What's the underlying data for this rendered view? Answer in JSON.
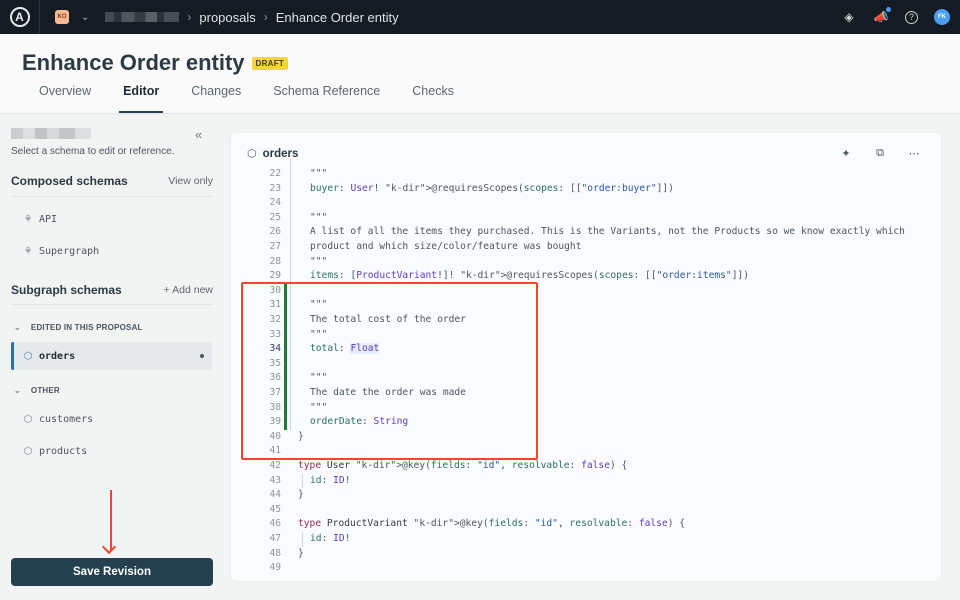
{
  "topbar": {
    "logo_letter": "A",
    "org_badge": "KO",
    "breadcrumbs": [
      "proposals",
      "Enhance Order entity"
    ],
    "icons": [
      "learn-icon",
      "announcements-icon",
      "help-icon"
    ],
    "avatar_initials": "FK"
  },
  "header": {
    "title": "Enhance Order entity",
    "badge": "DRAFT",
    "tabs": [
      {
        "label": "Overview",
        "active": false
      },
      {
        "label": "Editor",
        "active": true
      },
      {
        "label": "Changes",
        "active": false
      },
      {
        "label": "Schema Reference",
        "active": false
      },
      {
        "label": "Checks",
        "active": false
      }
    ]
  },
  "sidebar": {
    "hint": "Select a schema to edit or reference.",
    "composed": {
      "title": "Composed schemas",
      "action": "View only",
      "items": [
        "API",
        "Supergraph"
      ]
    },
    "subgraph": {
      "title": "Subgraph schemas",
      "action": "+ Add new",
      "groups": [
        {
          "label": "EDITED IN THIS PROPOSAL",
          "items": [
            "orders"
          ]
        },
        {
          "label": "OTHER",
          "items": [
            "customers",
            "products"
          ]
        }
      ]
    },
    "save_label": "Save Revision"
  },
  "editor": {
    "title": "orders",
    "tools": [
      "disable-suggestions-icon",
      "copy-icon",
      "more-icon"
    ],
    "current_line": 34,
    "added_lines": [
      30,
      31,
      32,
      33,
      34,
      35,
      36,
      37,
      38,
      39
    ],
    "lines": [
      {
        "n": "22",
        "t": "\"\"\""
      },
      {
        "n": "23",
        "t": "buyer: User! @requiresScopes(scopes: [[\"order:buyer\"]])"
      },
      {
        "n": "24",
        "t": ""
      },
      {
        "n": "25",
        "t": "\"\"\""
      },
      {
        "n": "26",
        "t": "A list of all the items they purchased. This is the Variants, not the Products so we know exactly which"
      },
      {
        "n": "27",
        "t": "product and which size/color/feature was bought"
      },
      {
        "n": "28",
        "t": "\"\"\""
      },
      {
        "n": "29",
        "t": "items: [ProductVariant!]! @requiresScopes(scopes: [[\"order:items\"]])"
      },
      {
        "n": "30",
        "t": ""
      },
      {
        "n": "31",
        "t": "\"\"\""
      },
      {
        "n": "32",
        "t": "The total cost of the order"
      },
      {
        "n": "33",
        "t": "\"\"\""
      },
      {
        "n": "34",
        "t": "total: Float"
      },
      {
        "n": "35",
        "t": ""
      },
      {
        "n": "36",
        "t": "\"\"\""
      },
      {
        "n": "37",
        "t": "The date the order was made"
      },
      {
        "n": "38",
        "t": "\"\"\""
      },
      {
        "n": "39",
        "t": "orderDate: String"
      },
      {
        "n": "40",
        "t": "}"
      },
      {
        "n": "41",
        "t": ""
      },
      {
        "n": "42",
        "t": "type User @key(fields: \"id\", resolvable: false) {"
      },
      {
        "n": "43",
        "t": "id: ID!"
      },
      {
        "n": "44",
        "t": "}"
      },
      {
        "n": "45",
        "t": ""
      },
      {
        "n": "46",
        "t": "type ProductVariant @key(fields: \"id\", resolvable: false) {"
      },
      {
        "n": "47",
        "t": "id: ID!"
      },
      {
        "n": "48",
        "t": "}"
      },
      {
        "n": "49",
        "t": ""
      }
    ]
  }
}
